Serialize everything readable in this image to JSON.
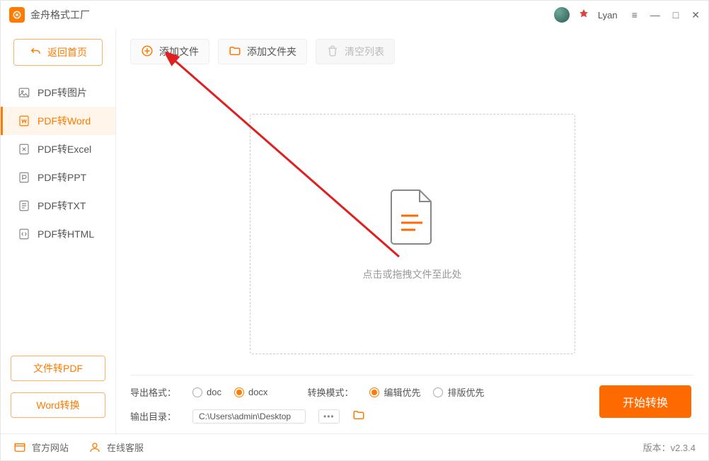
{
  "app": {
    "title": "金舟格式工厂"
  },
  "user": {
    "name": "Lyan"
  },
  "sidebar": {
    "back_home": "返回首页",
    "items": [
      {
        "label": "PDF转图片"
      },
      {
        "label": "PDF转Word"
      },
      {
        "label": "PDF转Excel"
      },
      {
        "label": "PDF转PPT"
      },
      {
        "label": "PDF转TXT"
      },
      {
        "label": "PDF转HTML"
      }
    ],
    "file_to_pdf": "文件转PDF",
    "word_convert": "Word转换"
  },
  "toolbar": {
    "add_file": "添加文件",
    "add_folder": "添加文件夹",
    "clear_list": "清空列表"
  },
  "dropzone": {
    "hint": "点击或拖拽文件至此处"
  },
  "controls": {
    "export_format_label": "导出格式：",
    "format_doc": "doc",
    "format_docx": "docx",
    "convert_mode_label": "转换模式：",
    "mode_edit": "编辑优先",
    "mode_layout": "排版优先",
    "output_dir_label": "输出目录：",
    "output_dir_value": "C:\\Users\\admin\\Desktop",
    "start_convert": "开始转换"
  },
  "footer": {
    "official_site": "官方网站",
    "online_support": "在线客服",
    "version_label": "版本：",
    "version_value": "v2.3.4"
  }
}
